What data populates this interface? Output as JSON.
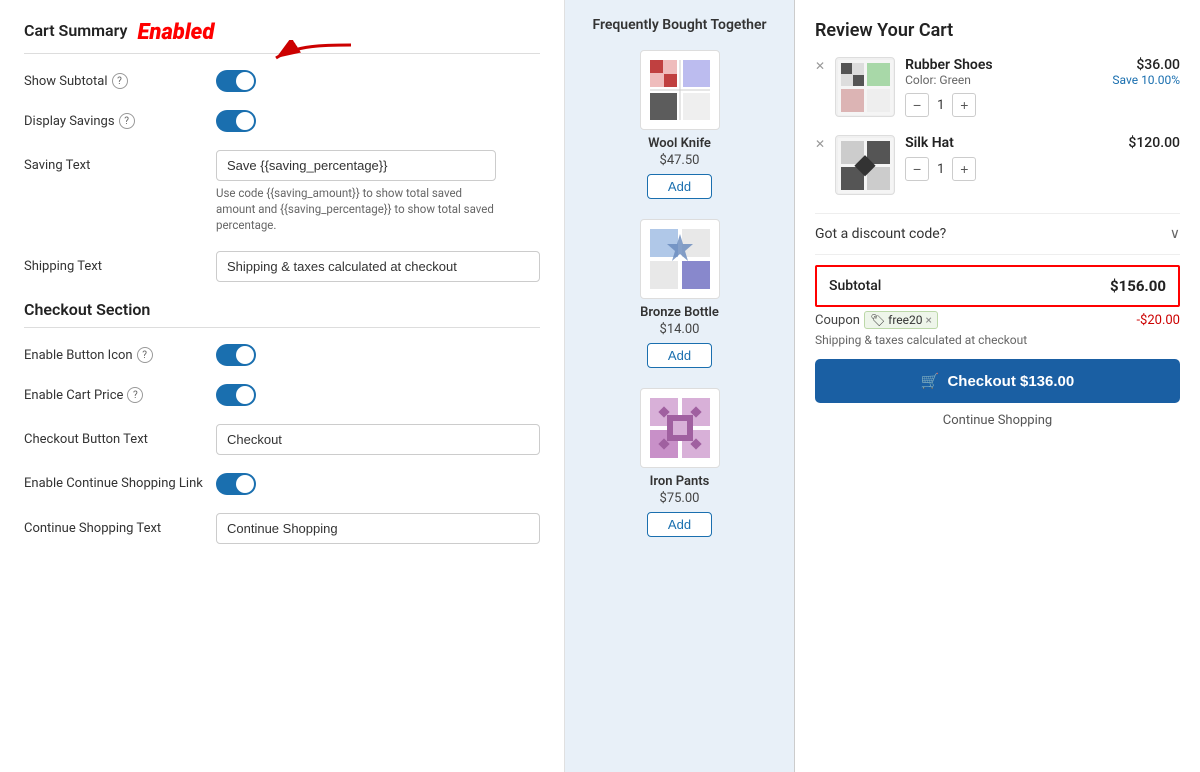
{
  "left": {
    "cartSummaryTitle": "Cart Summary",
    "enabledBadge": "Enabled",
    "showSubtotal": {
      "label": "Show Subtotal",
      "toggleOn": true
    },
    "displaySavings": {
      "label": "Display Savings",
      "toggleOn": true
    },
    "savingText": {
      "label": "Saving Text",
      "value": "Save {{saving_percentage}}",
      "hint": "Use code {{saving_amount}} to show total saved amount and {{saving_percentage}} to show total saved percentage."
    },
    "shippingText": {
      "label": "Shipping Text",
      "value": "Shipping & taxes calculated at checkout"
    },
    "checkoutSection": {
      "title": "Checkout Section",
      "enableButtonIcon": {
        "label": "Enable Button Icon",
        "toggleOn": true
      },
      "enableCartPrice": {
        "label": "Enable Cart Price",
        "toggleOn": true
      },
      "checkoutButtonText": {
        "label": "Checkout Button Text",
        "value": "Checkout"
      },
      "enableContinueShopping": {
        "label": "Enable Continue Shopping Link",
        "toggleOn": true
      },
      "continueShoppingText": {
        "label": "Continue Shopping Text",
        "value": "Continue Shopping"
      }
    }
  },
  "middle": {
    "title": "Frequently Bought Together",
    "products": [
      {
        "name": "Wool Knife",
        "price": "$47.50",
        "addLabel": "Add"
      },
      {
        "name": "Bronze Bottle",
        "price": "$14.00",
        "addLabel": "Add"
      },
      {
        "name": "Iron Pants",
        "price": "$75.00",
        "addLabel": "Add"
      }
    ]
  },
  "right": {
    "title": "Review Your Cart",
    "items": [
      {
        "name": "Rubber Shoes",
        "sub": "Color: Green",
        "qty": "1",
        "price": "$36.00",
        "save": "Save 10.00%"
      },
      {
        "name": "Silk Hat",
        "sub": "",
        "qty": "1",
        "price": "$120.00",
        "save": ""
      }
    ],
    "discountLabel": "Got a discount code?",
    "subtotalLabel": "Subtotal",
    "subtotalValue": "$156.00",
    "couponLabel": "Coupon",
    "couponCode": "free20",
    "couponDiscount": "-$20.00",
    "shippingNote": "Shipping & taxes calculated at checkout",
    "checkoutLabel": "Checkout $136.00",
    "continueShoppingLabel": "Continue Shopping"
  }
}
